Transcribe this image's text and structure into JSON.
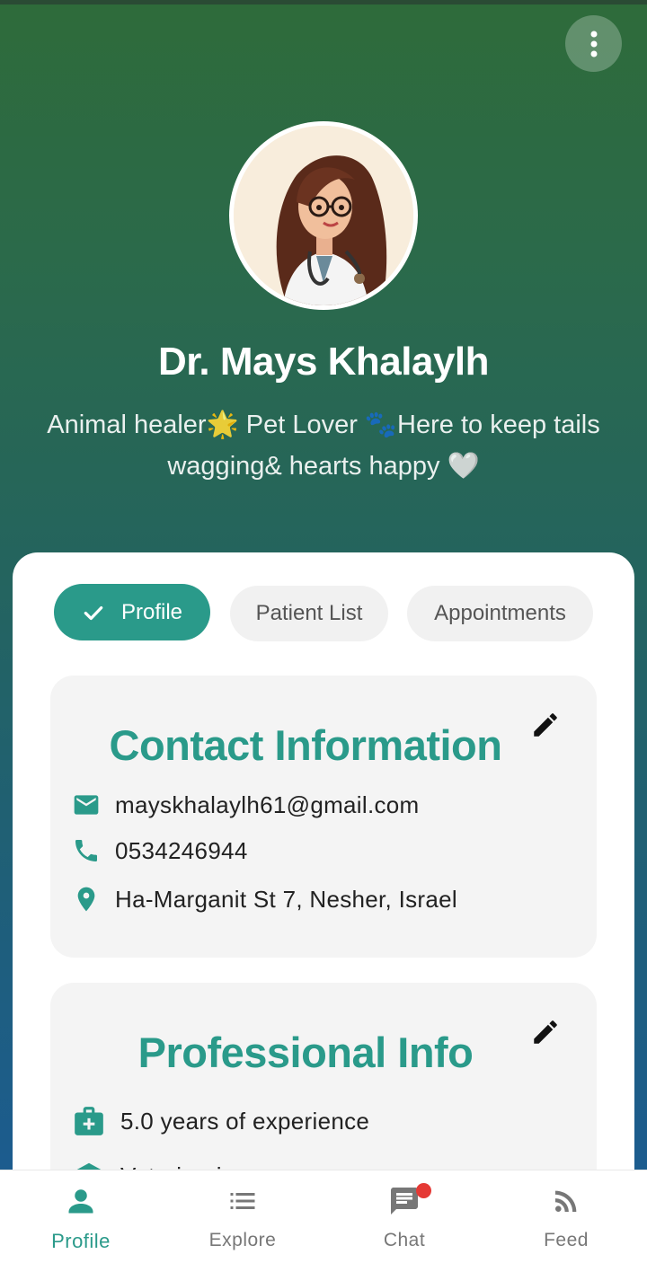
{
  "profile": {
    "name": "Dr. Mays Khalaylh",
    "bio": "Animal healer🌟 Pet Lover 🐾Here to keep tails wagging& hearts happy 🤍"
  },
  "tabs": [
    {
      "label": "Profile",
      "selected": true
    },
    {
      "label": "Patient List",
      "selected": false
    },
    {
      "label": "Appointments",
      "selected": false
    }
  ],
  "contact": {
    "title": "Contact Information",
    "email": "mayskhalaylh61@gmail.com",
    "phone": "0534246944",
    "address": "Ha-Marganit St 7, Nesher, Israel"
  },
  "professional": {
    "title": "Professional Info",
    "experience": "5.0 years of experience",
    "partial_item": "Veterinarian"
  },
  "bottom_nav": [
    {
      "label": "Profile",
      "icon": "person-icon",
      "active": true
    },
    {
      "label": "Explore",
      "icon": "list-icon",
      "active": false
    },
    {
      "label": "Chat",
      "icon": "chat-icon",
      "active": false,
      "badge": true
    },
    {
      "label": "Feed",
      "icon": "rss-icon",
      "active": false
    }
  ],
  "colors": {
    "accent": "#2a9a8a",
    "gradient_top": "#2e6b3a",
    "gradient_bottom": "#1b5b96",
    "badge": "#e53935"
  }
}
